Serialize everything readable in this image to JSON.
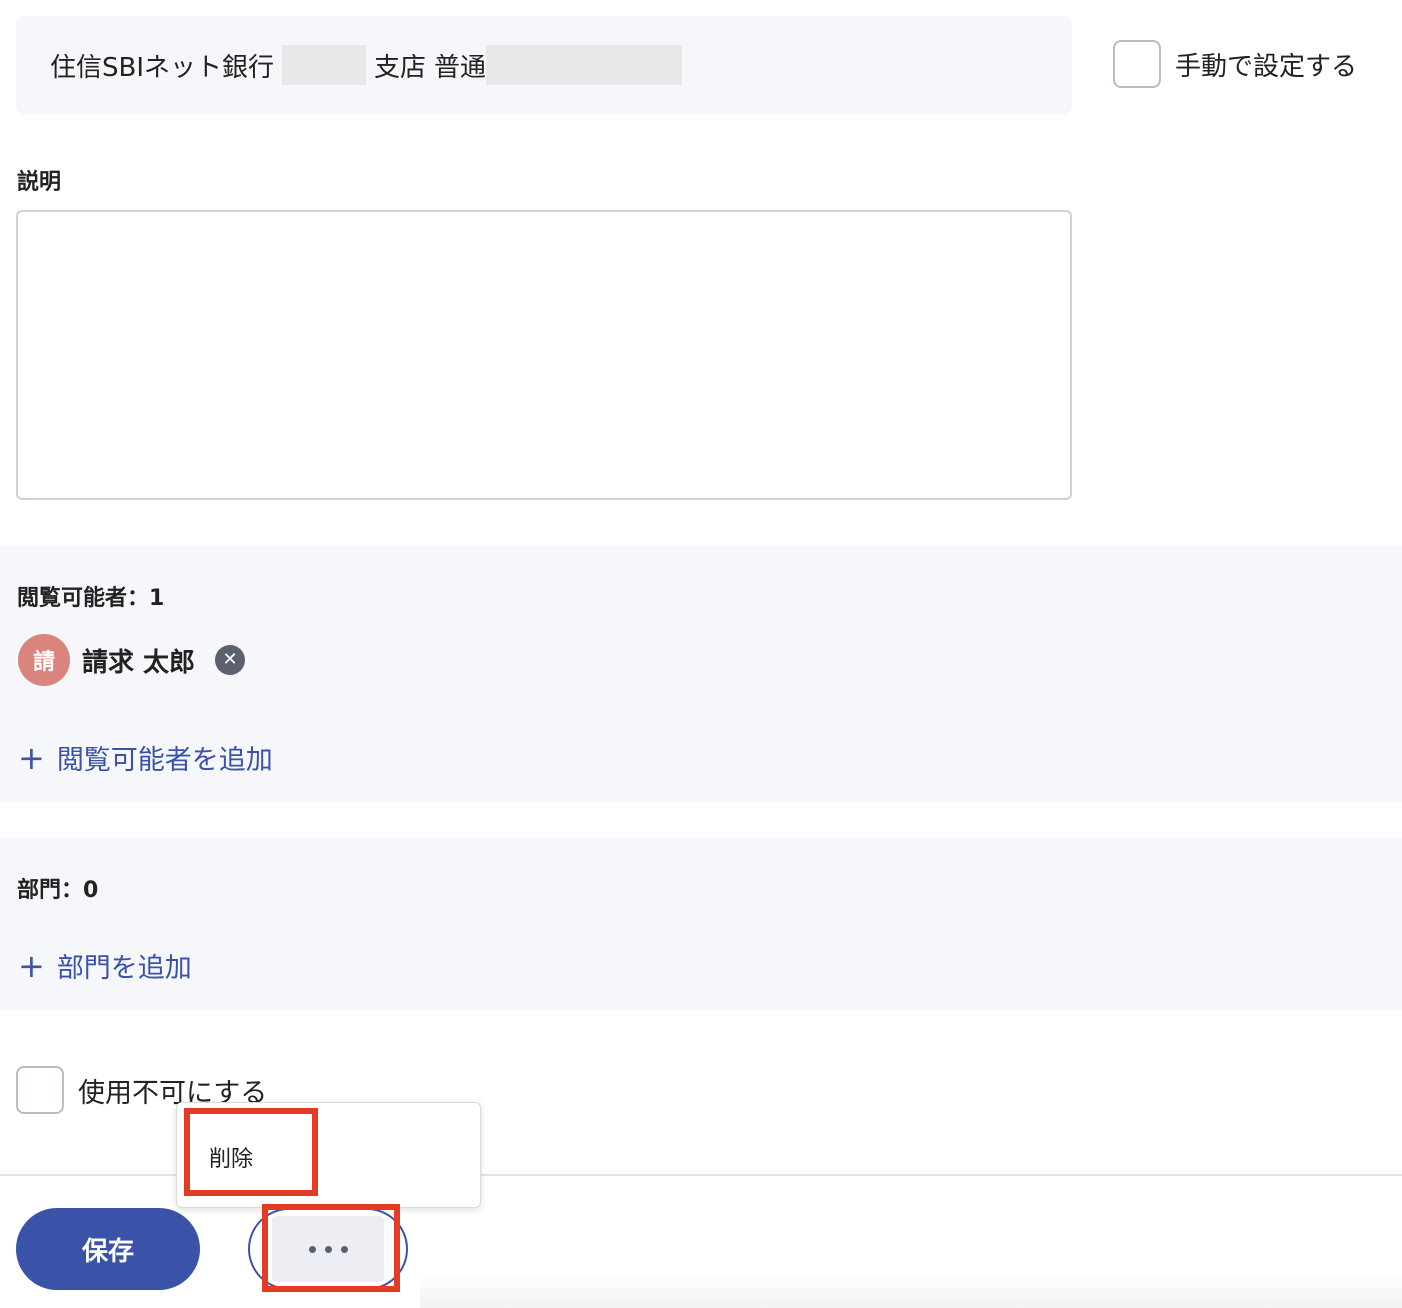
{
  "account": {
    "bank_name": "住信SBIネット銀行",
    "branch_suffix": "支店",
    "account_type": "普通"
  },
  "manual_setting": {
    "label": "手動で設定する",
    "checked": false
  },
  "description": {
    "label": "説明",
    "value": ""
  },
  "viewers": {
    "title": "閲覧可能者：1",
    "members": [
      {
        "avatar_char": "請",
        "name": "請求 太郎",
        "avatar_color": "#d9857d"
      }
    ],
    "add_label": "閲覧可能者を追加"
  },
  "departments": {
    "title": "部門：0",
    "add_label": "部門を追加"
  },
  "disable": {
    "label": "使用不可にする",
    "checked": false
  },
  "menu": {
    "items": [
      {
        "label": "削除"
      }
    ]
  },
  "footer": {
    "save_label": "保存",
    "more_icon": "ellipsis-icon"
  },
  "colors": {
    "primary": "#3a52a8",
    "section_bg": "#f6f7fa",
    "highlight": "#e53b24",
    "avatar": "#d9857d"
  }
}
